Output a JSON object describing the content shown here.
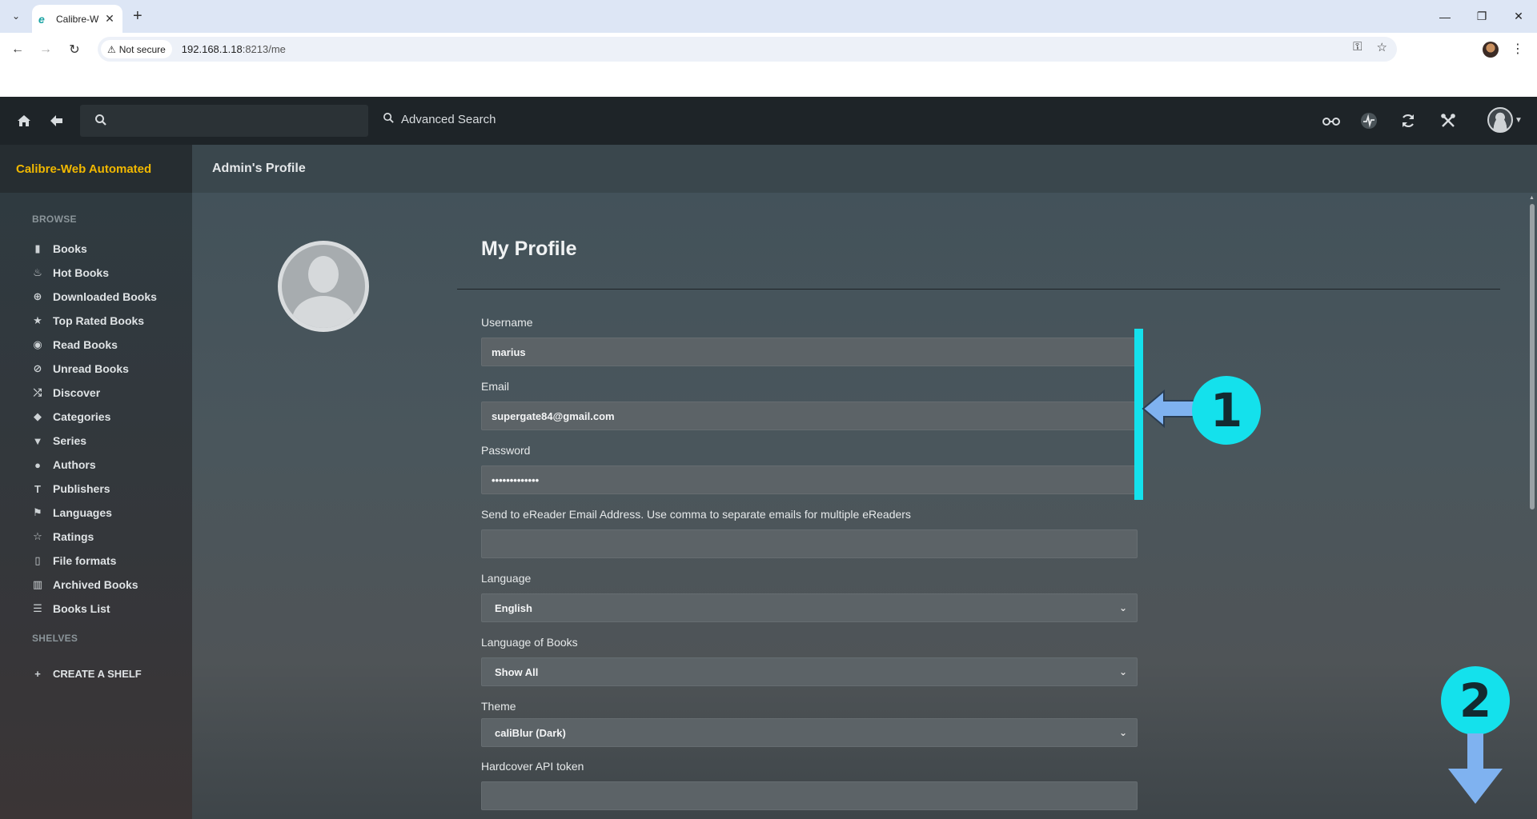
{
  "browser": {
    "tab_title": "Calibre-W",
    "tab_favicon": "e",
    "security_label": "Not secure",
    "url_host": "192.168.1.18",
    "url_rest": ":8213/me"
  },
  "header": {
    "advanced_search": "Advanced Search",
    "search_placeholder": ""
  },
  "brand": "Calibre-Web Automated",
  "page_heading": "Admin's Profile",
  "sidebar": {
    "browse_heading": "BROWSE",
    "shelves_heading": "SHELVES",
    "create_shelf": "CREATE A SHELF",
    "items": [
      {
        "label": "Books",
        "icon": "book-icon",
        "glyph": "▮"
      },
      {
        "label": "Hot Books",
        "icon": "fire-icon",
        "glyph": "♨"
      },
      {
        "label": "Downloaded Books",
        "icon": "download-icon",
        "glyph": "⊕"
      },
      {
        "label": "Top Rated Books",
        "icon": "star-icon",
        "glyph": "★"
      },
      {
        "label": "Read Books",
        "icon": "eye-icon",
        "glyph": "◉"
      },
      {
        "label": "Unread Books",
        "icon": "eye-slash-icon",
        "glyph": "⊘"
      },
      {
        "label": "Discover",
        "icon": "shuffle-icon",
        "glyph": "⤮"
      },
      {
        "label": "Categories",
        "icon": "tags-icon",
        "glyph": "◆"
      },
      {
        "label": "Series",
        "icon": "bookmark-icon",
        "glyph": "▼"
      },
      {
        "label": "Authors",
        "icon": "user-icon",
        "glyph": "●"
      },
      {
        "label": "Publishers",
        "icon": "text-size-icon",
        "glyph": "T"
      },
      {
        "label": "Languages",
        "icon": "flag-icon",
        "glyph": "⚑"
      },
      {
        "label": "Ratings",
        "icon": "star-outline-icon",
        "glyph": "☆"
      },
      {
        "label": "File formats",
        "icon": "file-icon",
        "glyph": "▯"
      },
      {
        "label": "Archived Books",
        "icon": "trash-icon",
        "glyph": "▥"
      },
      {
        "label": "Books List",
        "icon": "list-icon",
        "glyph": "☰"
      }
    ]
  },
  "form": {
    "title": "My Profile",
    "username_label": "Username",
    "username_value": "marius",
    "email_label": "Email",
    "email_value": "supergate84@gmail.com",
    "password_label": "Password",
    "password_value": "•••••••••••••",
    "ereader_label": "Send to eReader Email Address. Use comma to separate emails for multiple eReaders",
    "ereader_value": "",
    "language_label": "Language",
    "language_value": "English",
    "books_language_label": "Language of Books",
    "books_language_value": "Show All",
    "theme_label": "Theme",
    "theme_value": "caliBlur (Dark)",
    "hardcover_label": "Hardcover API token",
    "hardcover_value": ""
  },
  "annotations": {
    "step1": "1",
    "step2": "2",
    "color": "#14e1ec",
    "arrow_color": "#7fb2f0"
  }
}
